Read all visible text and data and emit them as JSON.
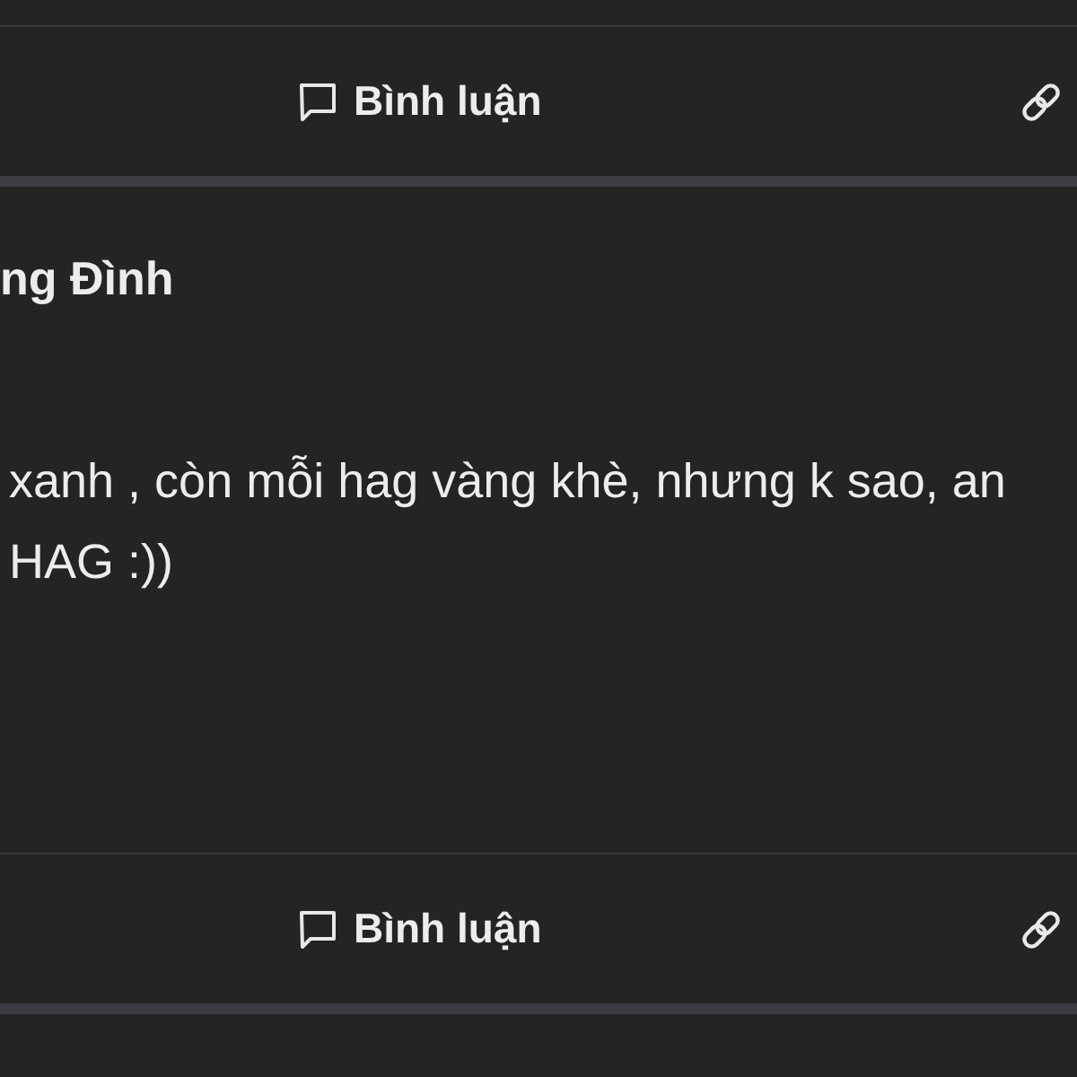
{
  "top_action_bar": {
    "comment_button": {
      "label": "Bình luận"
    }
  },
  "post": {
    "author": "ng Đình",
    "text_lines": [
      "xanh , còn mỗi hag vàng khè, nhưng k sao, an",
      "HAG :))"
    ],
    "action_bar": {
      "comment_button": {
        "label": "Bình luận"
      }
    }
  }
}
